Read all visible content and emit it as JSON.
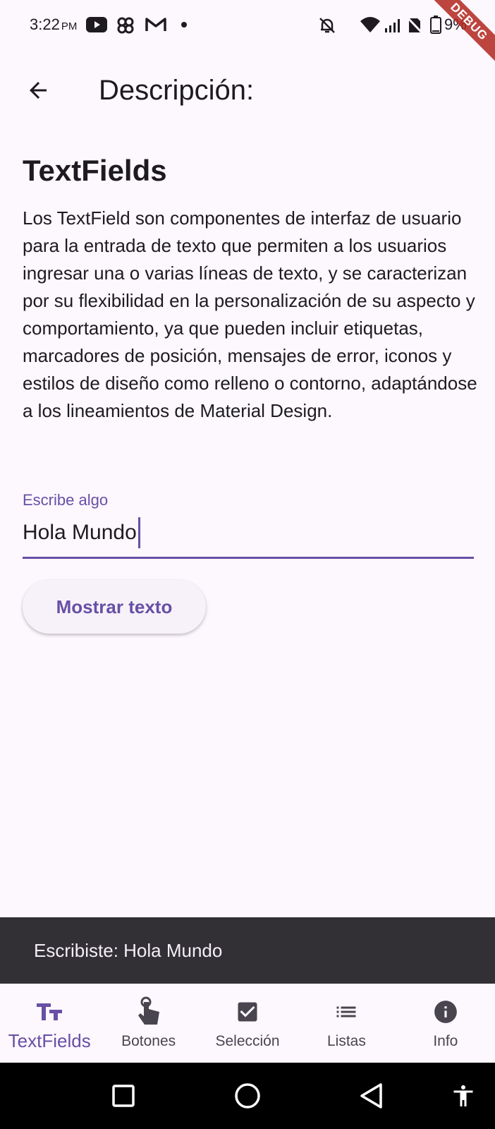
{
  "status_bar": {
    "time": "3:22",
    "ampm": "PM",
    "battery": "9%",
    "debug_label": "DEBUG",
    "icons": [
      "youtube-icon",
      "pinwheel-icon",
      "gmail-icon",
      "dot-icon",
      "notifications-off-icon",
      "wifi-icon",
      "signal-icon",
      "no-sim-icon",
      "battery-icon"
    ]
  },
  "app_bar": {
    "title": "Descripción:",
    "back_icon": "arrow-back-icon"
  },
  "content": {
    "section_title": "TextFields",
    "description": "Los TextField son componentes de interfaz de usuario para la entrada de texto que permiten a los usuarios ingresar una o varias líneas de texto, y se caracterizan por su flexibilidad en la personalización de su aspecto y comportamiento, ya que pueden incluir etiquetas, marcadores de posición, mensajes de error, iconos y estilos de diseño como relleno o contorno, adaptándose a los lineamientos de Material Design."
  },
  "text_field": {
    "label": "Escribe algo",
    "value": "Hola Mundo"
  },
  "button": {
    "label": "Mostrar texto"
  },
  "snackbar": {
    "text": "Escribiste: Hola Mundo"
  },
  "bottom_nav": {
    "items": [
      {
        "label": "TextFields",
        "icon": "text-fields-icon",
        "active": true
      },
      {
        "label": "Botones",
        "icon": "touch-icon",
        "active": false
      },
      {
        "label": "Selección",
        "icon": "checkbox-icon",
        "active": false
      },
      {
        "label": "Listas",
        "icon": "list-icon",
        "active": false
      },
      {
        "label": "Info",
        "icon": "info-icon",
        "active": false
      }
    ]
  },
  "system_nav": {
    "icons": [
      "recents-icon",
      "home-icon",
      "back-triangle-icon",
      "accessibility-icon"
    ]
  },
  "colors": {
    "primary": "#6750a4",
    "background": "#fdf7fe",
    "snackbar": "#322f35",
    "debug_ribbon": "#b3261e"
  }
}
